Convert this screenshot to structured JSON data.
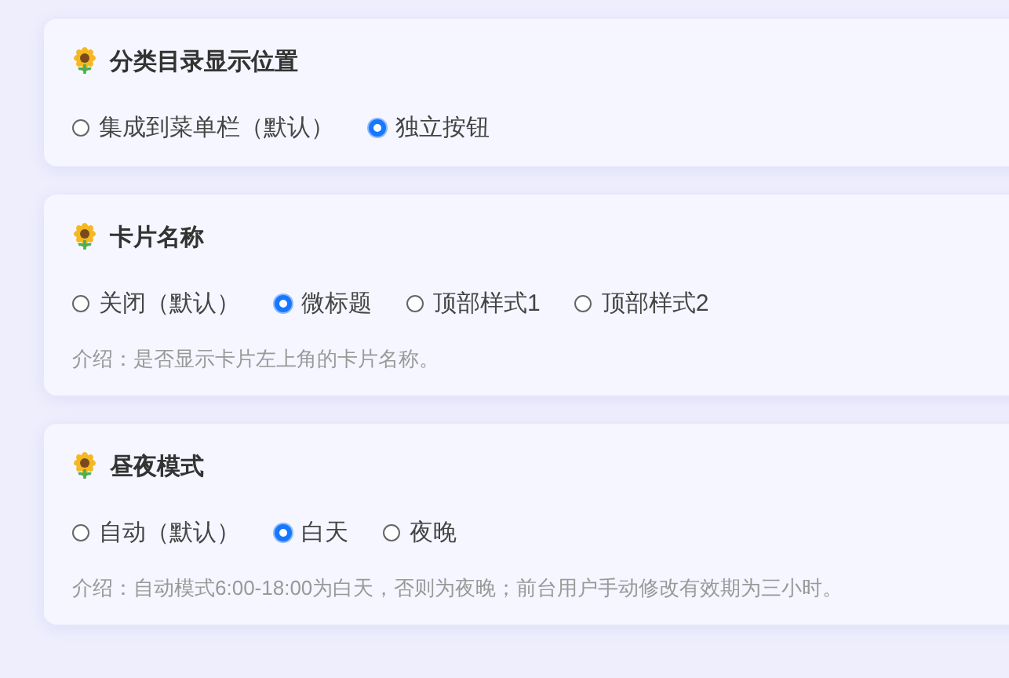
{
  "sections": [
    {
      "title": "分类目录显示位置",
      "options": [
        {
          "label": "集成到菜单栏（默认）",
          "selected": false
        },
        {
          "label": "独立按钮",
          "selected": true
        }
      ]
    },
    {
      "title": "卡片名称",
      "options": [
        {
          "label": "关闭（默认）",
          "selected": false
        },
        {
          "label": "微标题",
          "selected": true
        },
        {
          "label": "顶部样式1",
          "selected": false
        },
        {
          "label": "顶部样式2",
          "selected": false
        }
      ],
      "intro": "介绍：是否显示卡片左上角的卡片名称。"
    },
    {
      "title": "昼夜模式",
      "options": [
        {
          "label": "自动（默认）",
          "selected": false
        },
        {
          "label": "白天",
          "selected": true
        },
        {
          "label": "夜晚",
          "selected": false
        }
      ],
      "intro": "介绍：自动模式6:00-18:00为白天，否则为夜晚；前台用户手动修改有效期为三小时。"
    }
  ]
}
